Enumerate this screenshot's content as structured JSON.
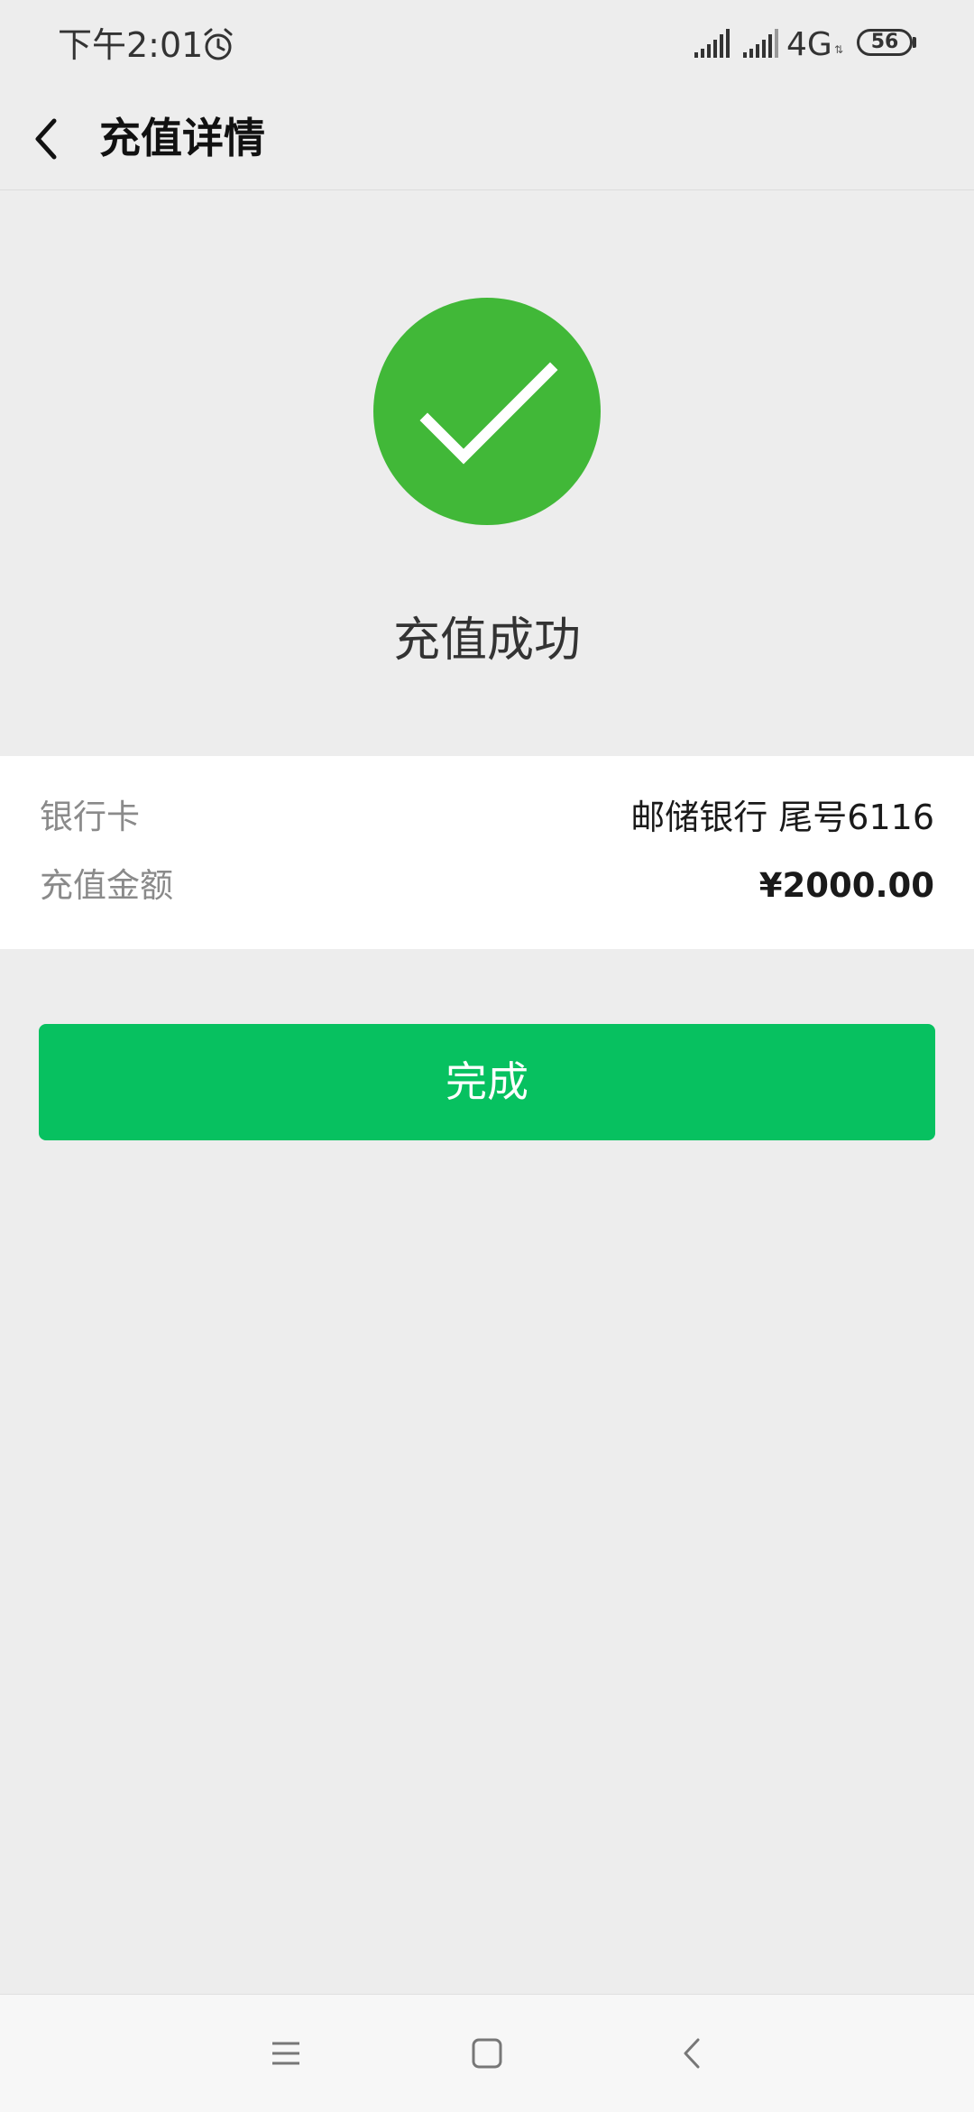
{
  "status_bar": {
    "time": "下午2:01",
    "network": "4G",
    "network_arrows": "⇅",
    "battery": "56",
    "icons": [
      "alarm-icon",
      "signal-icon",
      "signal-icon"
    ]
  },
  "header": {
    "back_icon": "chevron-left-icon",
    "title": "充值详情"
  },
  "result": {
    "icon": "check-circle-icon",
    "status": "充值成功",
    "accent_color": "#41b838"
  },
  "details": {
    "bank_card_label": "银行卡",
    "bank_card_value": "邮储银行 尾号6116",
    "amount_label": "充值金额",
    "amount_value": "¥2000.00"
  },
  "actions": {
    "done_label": "完成",
    "done_color": "#07c160"
  },
  "nav_bar": {
    "icons": [
      "menu-icon",
      "home-icon",
      "back-icon"
    ]
  }
}
